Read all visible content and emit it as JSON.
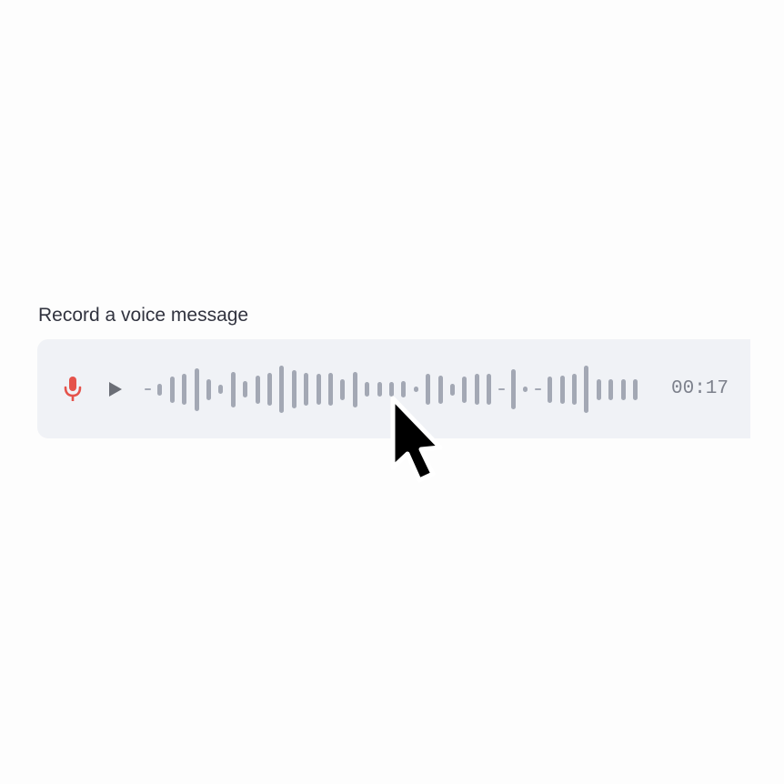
{
  "widget": {
    "label": "Record a voice message",
    "elapsed_time": "00:17"
  },
  "icons": {
    "record": "microphone-icon",
    "play": "play-icon",
    "pointer": "mouse-cursor-icon"
  },
  "colors": {
    "mic_red": "#e5534b",
    "play_grey": "#6b6e76",
    "waveform_grey": "#a3a8b4",
    "panel_background": "#f0f2f6",
    "label_text": "#31333f",
    "time_text": "#7d818c"
  },
  "waveform": {
    "levels": [
      0.05,
      0.25,
      0.55,
      0.65,
      0.9,
      0.45,
      0.2,
      0.75,
      0.35,
      0.6,
      0.7,
      1.0,
      0.8,
      0.7,
      0.65,
      0.7,
      0.45,
      0.75,
      0.3,
      0.3,
      0.3,
      0.35,
      0.12,
      0.65,
      0.6,
      0.25,
      0.55,
      0.65,
      0.65,
      0.05,
      0.85,
      0.12,
      0.05,
      0.55,
      0.6,
      0.65,
      1.0,
      0.45,
      0.45,
      0.45,
      0.45
    ]
  }
}
